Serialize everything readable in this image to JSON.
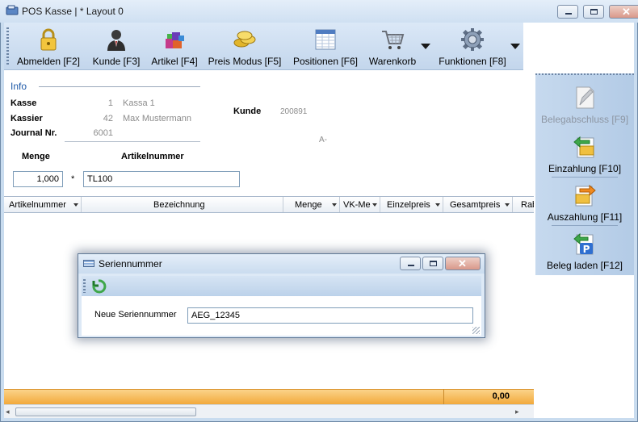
{
  "window": {
    "title": "POS Kasse | * Layout 0"
  },
  "toolbar": {
    "items": [
      {
        "label": "Abmelden [F2]",
        "icon": "lock-icon"
      },
      {
        "label": "Kunde [F3]",
        "icon": "customer-icon"
      },
      {
        "label": "Artikel [F4]",
        "icon": "articles-icon"
      },
      {
        "label": "Preis Modus [F5]",
        "icon": "coins-icon"
      },
      {
        "label": "Positionen [F6]",
        "icon": "positions-icon"
      },
      {
        "label": "Warenkorb",
        "icon": "cart-icon"
      },
      {
        "label": "Funktionen [F8]",
        "icon": "gear-icon"
      }
    ]
  },
  "right_panel": {
    "items": [
      {
        "label": "Belegabschluss [F9]",
        "enabled": false
      },
      {
        "label": "Einzahlung [F10]",
        "enabled": true
      },
      {
        "label": "Auszahlung [F11]",
        "enabled": true
      },
      {
        "label": "Beleg laden [F12]",
        "enabled": true
      }
    ]
  },
  "info": {
    "heading": "Info",
    "kasse_label": "Kasse",
    "kasse_nr": "1",
    "kasse_name": "Kassa 1",
    "kassier_label": "Kassier",
    "kassier_nr": "42",
    "kassier_name": "Max Mustermann",
    "journal_label": "Journal Nr.",
    "journal_nr": "6001",
    "kunde_label": "Kunde",
    "kunde_nr": "200891",
    "kunde_extra": "A-"
  },
  "entry": {
    "menge_label": "Menge",
    "artikel_label": "Artikelnummer",
    "menge_value": "1,000",
    "multiply": "*",
    "artikel_value": "TL100"
  },
  "grid": {
    "columns": [
      "Artikelnummer",
      "Bezeichnung",
      "Menge",
      "VK-Me",
      "Einzelpreis",
      "Gesamtpreis",
      "Rab"
    ],
    "total": "0,00"
  },
  "dialog": {
    "title": "Seriennummer",
    "field_label": "Neue Seriennummer",
    "field_value": "AEG_12345"
  },
  "colors": {
    "accent": "#c3d6ec",
    "footer": "#f2a93b",
    "info_heading": "#1f5aa8"
  }
}
